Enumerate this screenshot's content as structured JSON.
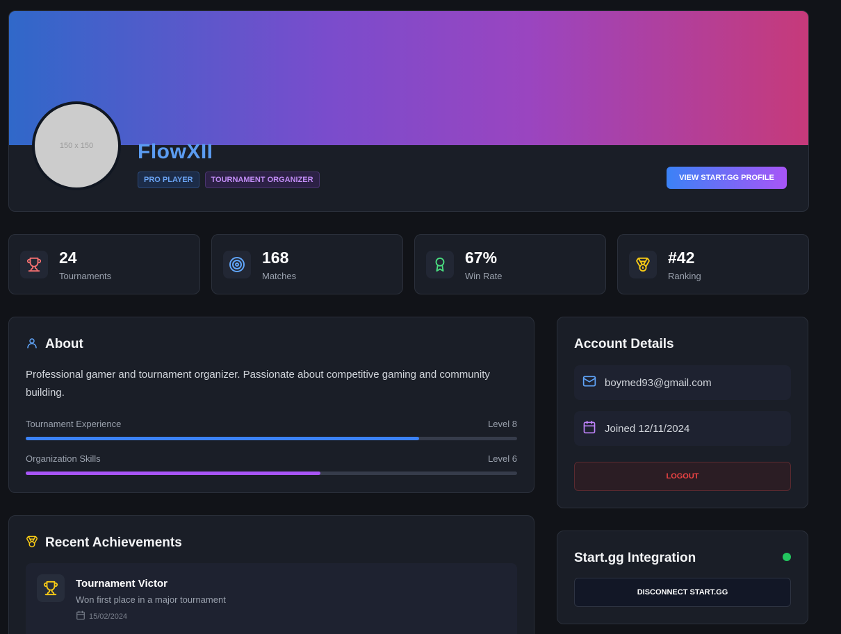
{
  "profile": {
    "avatar_placeholder": "150 x 150",
    "username": "FlowXII",
    "badges": [
      "PRO PLAYER",
      "TOURNAMENT ORGANIZER"
    ],
    "startgg_button": "VIEW START.GG PROFILE"
  },
  "stats": [
    {
      "value": "24",
      "label": "Tournaments",
      "icon": "trophy-icon",
      "color": "#f87171"
    },
    {
      "value": "168",
      "label": "Matches",
      "icon": "target-icon",
      "color": "#60a5fa"
    },
    {
      "value": "67%",
      "label": "Win Rate",
      "icon": "award-icon",
      "color": "#4ade80"
    },
    {
      "value": "#42",
      "label": "Ranking",
      "icon": "medal-icon",
      "color": "#facc15"
    }
  ],
  "about": {
    "title": "About",
    "text": "Professional gamer and tournament organizer. Passionate about competitive gaming and community building.",
    "skills": [
      {
        "label": "Tournament Experience",
        "level": "Level 8",
        "progress": 0.8,
        "color": "#3b82f6"
      },
      {
        "label": "Organization Skills",
        "level": "Level 6",
        "progress": 0.6,
        "color": "#a855f7"
      }
    ]
  },
  "achievements": {
    "title": "Recent Achievements",
    "items": [
      {
        "title": "Tournament Victor",
        "description": "Won first place in a major tournament",
        "date": "15/02/2024"
      }
    ]
  },
  "account": {
    "title": "Account Details",
    "email": "boymed93@gmail.com",
    "joined": "Joined 12/11/2024",
    "logout": "LOGOUT"
  },
  "integration": {
    "title": "Start.gg Integration",
    "status_color": "#22c55e",
    "disconnect": "DISCONNECT START.GG"
  }
}
